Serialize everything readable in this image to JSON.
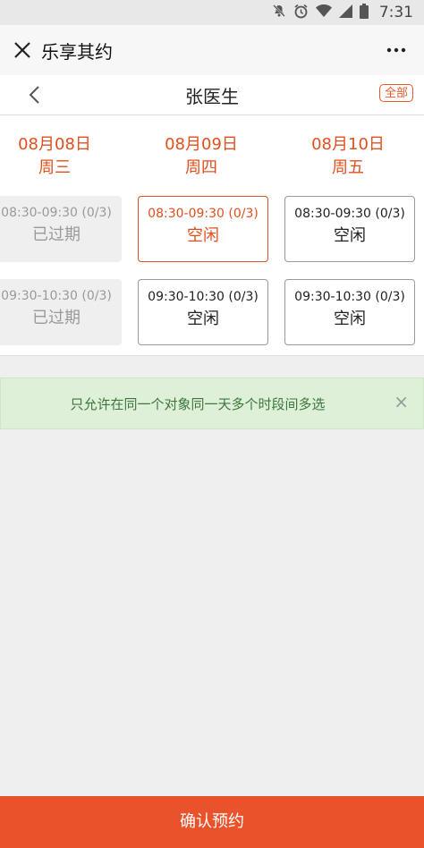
{
  "status_bar": {
    "time": "7:31"
  },
  "app_bar": {
    "title": "乐享其约"
  },
  "doctor_bar": {
    "title": "张医生",
    "all_label": "全部"
  },
  "schedule": {
    "days": [
      {
        "date": "08月08日",
        "weekday": "周三"
      },
      {
        "date": "08月09日",
        "weekday": "周四"
      },
      {
        "date": "08月10日",
        "weekday": "周五"
      }
    ],
    "rows": [
      [
        {
          "time": "08:30-09:30 (0/3)",
          "status": "已过期",
          "state": "past"
        },
        {
          "time": "08:30-09:30 (0/3)",
          "status": "空闲",
          "state": "selected"
        },
        {
          "time": "08:30-09:30 (0/3)",
          "status": "空闲",
          "state": "free"
        }
      ],
      [
        {
          "time": "09:30-10:30 (0/3)",
          "status": "已过期",
          "state": "past"
        },
        {
          "time": "09:30-10:30 (0/3)",
          "status": "空闲",
          "state": "free"
        },
        {
          "time": "09:30-10:30 (0/3)",
          "status": "空闲",
          "state": "free"
        }
      ]
    ]
  },
  "notice": {
    "text": "只允许在同一个对象同一天多个时段间多选",
    "close_symbol": "×"
  },
  "confirm_button": {
    "label": "确认预约"
  },
  "colors": {
    "accent": "#e0501e",
    "button": "#e9522a",
    "notice_bg": "#dff0d8",
    "notice_text": "#3c763d"
  }
}
